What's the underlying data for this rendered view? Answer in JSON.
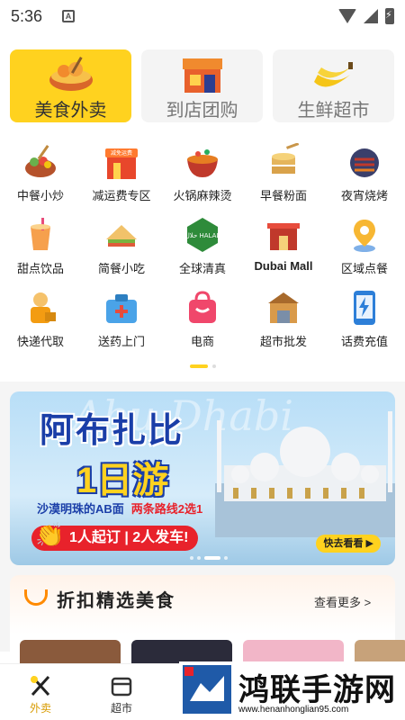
{
  "status_bar": {
    "time": "5:36",
    "notif_letter": "A"
  },
  "top_categories": [
    {
      "label": "美食外卖",
      "active": true
    },
    {
      "label": "到店团购",
      "active": false
    },
    {
      "label": "生鲜超市",
      "active": false
    }
  ],
  "grid": [
    [
      {
        "label": "中餐小炒"
      },
      {
        "label": "减运费专区",
        "badge": "减免运费"
      },
      {
        "label": "火锅麻辣烫"
      },
      {
        "label": "早餐粉面"
      },
      {
        "label": "夜宵烧烤"
      }
    ],
    [
      {
        "label": "甜点饮品"
      },
      {
        "label": "简餐小吃"
      },
      {
        "label": "全球清真",
        "badge": "حلال HALAL"
      },
      {
        "label": "Dubai Mall"
      },
      {
        "label": "区域点餐"
      }
    ],
    [
      {
        "label": "快递代取"
      },
      {
        "label": "送药上门"
      },
      {
        "label": "电商"
      },
      {
        "label": "超市批发"
      },
      {
        "label": "话费充值"
      }
    ]
  ],
  "banner": {
    "title": "阿布扎比",
    "day": "1日游",
    "subtitle_blue": "沙漠明珠的AB面",
    "subtitle_red": "两条路线2选1",
    "pill": "1人起订 | 2人发车!",
    "cta": "快去看看 ▶",
    "bg_script": "Abu Dhabi"
  },
  "discount": {
    "title": "折扣精选美食",
    "more": "查看更多 >"
  },
  "bottom_nav": [
    {
      "label": "外卖",
      "active": true
    },
    {
      "label": "超市",
      "active": false
    }
  ],
  "watermark": {
    "text": "鸿联手游网",
    "url": "www.henanhonglian95.com"
  },
  "colors": {
    "accent": "#ffd21f",
    "banner_blue": "#1a3ea8",
    "red": "#e8222b"
  }
}
